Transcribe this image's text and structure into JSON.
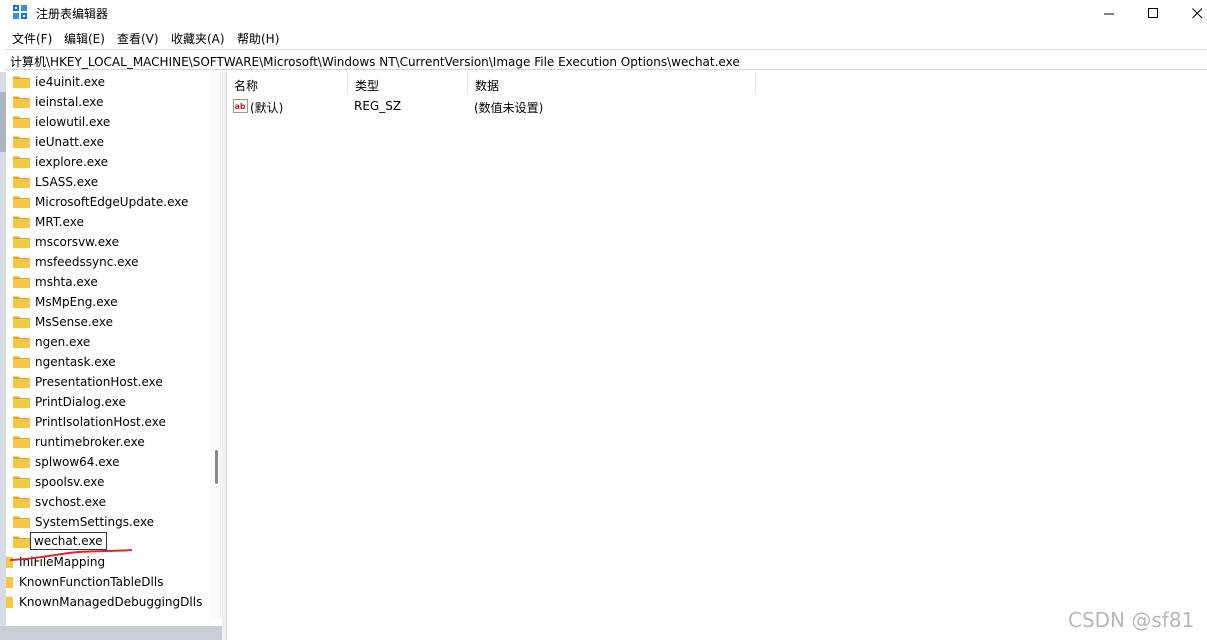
{
  "window": {
    "title": "注册表编辑器",
    "buttons": {
      "minimize": "—",
      "maximize": "☐",
      "close": "✕"
    }
  },
  "menu": [
    {
      "label": "文件(F)"
    },
    {
      "label": "编辑(E)"
    },
    {
      "label": "查看(V)"
    },
    {
      "label": "收藏夹(A)"
    },
    {
      "label": "帮助(H)"
    }
  ],
  "address": {
    "path": "计算机\\HKEY_LOCAL_MACHINE\\SOFTWARE\\Microsoft\\Windows NT\\CurrentVersion\\Image File Execution Options\\wechat.exe"
  },
  "tree": {
    "items": [
      {
        "label": "ie4uinit.exe"
      },
      {
        "label": "ieinstal.exe"
      },
      {
        "label": "ielowutil.exe"
      },
      {
        "label": "ieUnatt.exe"
      },
      {
        "label": "iexplore.exe"
      },
      {
        "label": "LSASS.exe"
      },
      {
        "label": "MicrosoftEdgeUpdate.exe"
      },
      {
        "label": "MRT.exe"
      },
      {
        "label": "mscorsvw.exe"
      },
      {
        "label": "msfeedssync.exe"
      },
      {
        "label": "mshta.exe"
      },
      {
        "label": "MsMpEng.exe"
      },
      {
        "label": "MsSense.exe"
      },
      {
        "label": "ngen.exe"
      },
      {
        "label": "ngentask.exe"
      },
      {
        "label": "PresentationHost.exe"
      },
      {
        "label": "PrintDialog.exe"
      },
      {
        "label": "PrintIsolationHost.exe"
      },
      {
        "label": "runtimebroker.exe"
      },
      {
        "label": "splwow64.exe"
      },
      {
        "label": "spoolsv.exe"
      },
      {
        "label": "svchost.exe"
      },
      {
        "label": "SystemSettings.exe"
      },
      {
        "label": "wechat.exe",
        "selected": true
      },
      {
        "label": "IniFileMapping"
      },
      {
        "label": "KnownFunctionTableDlls"
      },
      {
        "label": "KnownManagedDebuggingDlls"
      }
    ]
  },
  "list": {
    "columns": [
      {
        "label": "名称"
      },
      {
        "label": "类型"
      },
      {
        "label": "数据"
      }
    ],
    "rows": [
      {
        "name": "(默认)",
        "type": "REG_SZ",
        "data": "(数值未设置)"
      }
    ]
  },
  "watermark": "CSDN @sf81",
  "colors": {
    "folder": "#f5c74c",
    "folder_dark": "#e6a823",
    "annotation": "#e0252b",
    "app_icon": "#1e73d9"
  }
}
